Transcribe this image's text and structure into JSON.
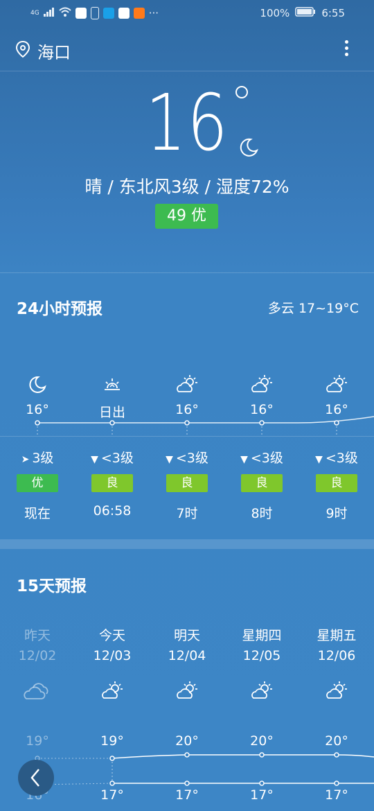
{
  "status_bar": {
    "network": "4G",
    "battery": "100%",
    "time": "6:55",
    "more": "···"
  },
  "header": {
    "city": "海口"
  },
  "current": {
    "temperature": "16",
    "condition": "晴 / 东北风3级 / 湿度72%",
    "aqi": "49 优"
  },
  "hourly": {
    "title": "24小时预报",
    "summary": "多云 17~19°C",
    "items": [
      {
        "icon": "moon-icon",
        "temp": "16°",
        "wind": "3级",
        "aqi": "优",
        "aqi_color": "#3dbb50",
        "time": "现在"
      },
      {
        "icon": "sunrise-icon",
        "temp": "日出",
        "wind": "<3级",
        "aqi": "良",
        "aqi_color": "#7fc72c",
        "time": "06:58"
      },
      {
        "icon": "partly-cloudy-icon",
        "temp": "16°",
        "wind": "<3级",
        "aqi": "良",
        "aqi_color": "#7fc72c",
        "time": "7时"
      },
      {
        "icon": "partly-cloudy-icon",
        "temp": "16°",
        "wind": "<3级",
        "aqi": "良",
        "aqi_color": "#7fc72c",
        "time": "8时"
      },
      {
        "icon": "partly-cloudy-icon",
        "temp": "16°",
        "wind": "<3级",
        "aqi": "良",
        "aqi_color": "#7fc72c",
        "time": "9时"
      }
    ]
  },
  "daily": {
    "title": "15天预报",
    "items": [
      {
        "day": "昨天",
        "date": "12/02",
        "icon": "cloudy-icon",
        "high": "19°",
        "low": "16°",
        "past": true
      },
      {
        "day": "今天",
        "date": "12/03",
        "icon": "partly-cloudy-icon",
        "high": "19°",
        "low": "17°",
        "past": false
      },
      {
        "day": "明天",
        "date": "12/04",
        "icon": "partly-cloudy-icon",
        "high": "20°",
        "low": "17°",
        "past": false
      },
      {
        "day": "星期四",
        "date": "12/05",
        "icon": "partly-cloudy-icon",
        "high": "20°",
        "low": "17°",
        "past": false
      },
      {
        "day": "星期五",
        "date": "12/06",
        "icon": "partly-cloudy-icon",
        "high": "20°",
        "low": "17°",
        "past": false
      }
    ]
  },
  "colors": {
    "aqi_excellent": "#3dbb50",
    "aqi_good": "#7fc72c"
  }
}
